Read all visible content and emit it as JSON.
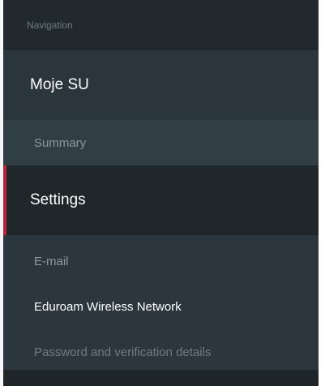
{
  "nav": {
    "header": "Navigation",
    "top_item": "Moje SU",
    "summary": "Summary",
    "settings": "Settings",
    "accent_color": "#b8243a",
    "sub_items": [
      {
        "label": "E-mail"
      },
      {
        "label": "Eduroam Wireless Network"
      },
      {
        "label": "Password and verification details"
      }
    ]
  }
}
